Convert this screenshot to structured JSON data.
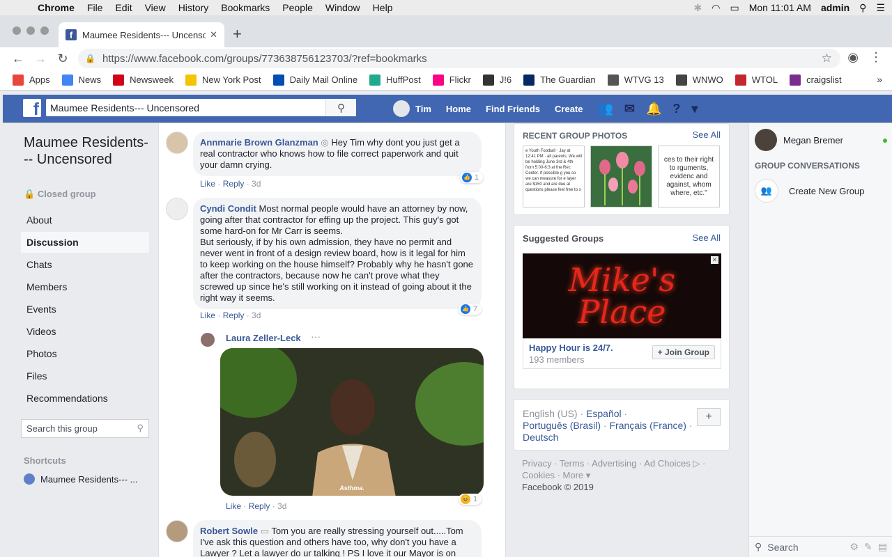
{
  "macos": {
    "app": "Chrome",
    "menus": [
      "File",
      "Edit",
      "View",
      "History",
      "Bookmarks",
      "People",
      "Window",
      "Help"
    ],
    "clock": "Mon 11:01 AM",
    "user": "admin"
  },
  "browser": {
    "tab_title": "Maumee Residents--- Uncenso",
    "url": "https://www.facebook.com/groups/773638756123703/?ref=bookmarks",
    "bookmarks": [
      {
        "label": "Apps",
        "color": "#e8453c",
        "icon": "apps-grid-icon"
      },
      {
        "label": "News",
        "color": "#4285f4",
        "icon": "google-news-icon"
      },
      {
        "label": "Newsweek",
        "color": "#d0021b",
        "icon": "newsweek-icon"
      },
      {
        "label": "New York Post",
        "color": "#f5c400",
        "icon": "nypost-icon"
      },
      {
        "label": "Daily Mail Online",
        "color": "#004db3",
        "icon": "dailymail-icon"
      },
      {
        "label": "HuffPost",
        "color": "#1fab89",
        "icon": "huffpost-icon"
      },
      {
        "label": "Flickr",
        "color": "#ff0084",
        "icon": "flickr-icon"
      },
      {
        "label": "J!6",
        "color": "#333333",
        "icon": "j6-icon"
      },
      {
        "label": "The Guardian",
        "color": "#052962",
        "icon": "guardian-icon"
      },
      {
        "label": "WTVG 13",
        "color": "#555555",
        "icon": "wtvg-icon"
      },
      {
        "label": "WNWO",
        "color": "#444444",
        "icon": "globe-icon"
      },
      {
        "label": "WTOL",
        "color": "#c4262e",
        "icon": "wtol-icon"
      },
      {
        "label": "craigslist",
        "color": "#7b2d8e",
        "icon": "peace-icon"
      }
    ]
  },
  "fb": {
    "search_value": "Maumee Residents--- Uncensored",
    "user": "Tim",
    "nav": [
      "Home",
      "Find Friends",
      "Create"
    ]
  },
  "group": {
    "name": "Maumee Residents--- Uncensored",
    "privacy": "Closed group",
    "nav": [
      "About",
      "Discussion",
      "Chats",
      "Members",
      "Events",
      "Videos",
      "Photos",
      "Files",
      "Recommendations"
    ],
    "active_nav": "Discussion",
    "search_placeholder": "Search this group",
    "shortcuts_label": "Shortcuts",
    "shortcut": "Maumee Residents--- ..."
  },
  "comments": [
    {
      "author": "Annmarie Brown Glanzman",
      "text": " Hey Tim why dont you just get a real contractor who knows how to file correct paperwork and quit your damn crying.",
      "like": "Like",
      "reply": "Reply",
      "time": "3d",
      "reactions": "1"
    },
    {
      "author": "Cyndi Condit",
      "text": " Most normal people would have an attorney by now, going after that contractor for effing up the project. This guy's got some hard-on for Mr Carr is seems.",
      "text2": "But seriously, if by his own admission, they have no permit and never went in front of a design review board, how is it legal for him to keep working on the house himself? Probably why he hasn't gone after the contractors, because now he can't prove what they screwed up since he's still working on it instead of going about it the right way it seems.",
      "like": "Like",
      "reply": "Reply",
      "time": "3d",
      "reactions": "7"
    },
    {
      "author": "Laura Zeller-Leck",
      "gif_caption": "Asthma.",
      "like": "Like",
      "reply": "Reply",
      "time": "3d",
      "reactions": "1"
    },
    {
      "author": "Robert Sowle",
      "text": " Tom you are really stressing yourself out.....Tom I've ask this question and others have too, why don't you have a Lawyer ? Let a lawyer do ur talking ! PS I love it our Mayor is on"
    }
  ],
  "right": {
    "photos_header": "RECENT GROUP PHOTOS",
    "see_all": "See All",
    "thumb1": "e Youth Football · Jay at 12:41 PM · all parents: We will be holding June 3rd & 4th from 5:00-6:3 at the Rec Center. If possible g you so we can measure for e layer are $150 and are due at questions please feel free to s",
    "thumb3": "ces to their right to rguments, evidenc and against, whom where, etc.\"",
    "suggested_header": "Suggested Groups",
    "ad_line1": "Mike's",
    "ad_line2": "Place",
    "ad_name": "Happy Hour is 24/7.",
    "ad_members": "193 members",
    "join": "Join Group",
    "lang_current": "English (US)",
    "langs": [
      "Español",
      "Português (Brasil)",
      "Français (France)",
      "Deutsch"
    ],
    "footer_links": "Privacy · Terms · Advertising · Ad Choices ▷ · Cookies · More ▾",
    "copyright": "Facebook © 2019"
  },
  "chat": {
    "contact": "Megan Bremer",
    "group_conv": "GROUP CONVERSATIONS",
    "create": "Create New Group",
    "search": "Search"
  }
}
